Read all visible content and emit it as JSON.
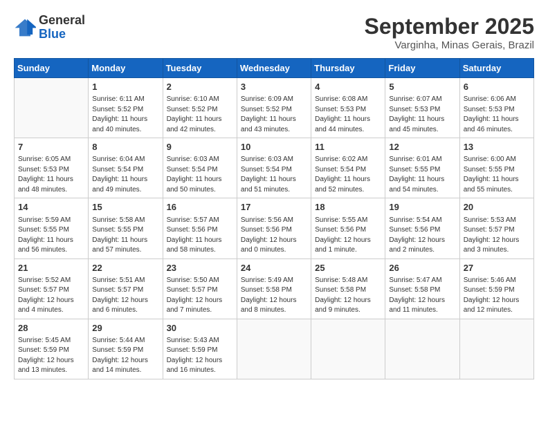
{
  "header": {
    "logo_line1": "General",
    "logo_line2": "Blue",
    "month": "September 2025",
    "location": "Varginha, Minas Gerais, Brazil"
  },
  "weekdays": [
    "Sunday",
    "Monday",
    "Tuesday",
    "Wednesday",
    "Thursday",
    "Friday",
    "Saturday"
  ],
  "weeks": [
    [
      {
        "day": "",
        "sunrise": "",
        "sunset": "",
        "daylight": ""
      },
      {
        "day": "1",
        "sunrise": "6:11 AM",
        "sunset": "5:52 PM",
        "daylight": "11 hours and 40 minutes."
      },
      {
        "day": "2",
        "sunrise": "6:10 AM",
        "sunset": "5:52 PM",
        "daylight": "11 hours and 42 minutes."
      },
      {
        "day": "3",
        "sunrise": "6:09 AM",
        "sunset": "5:52 PM",
        "daylight": "11 hours and 43 minutes."
      },
      {
        "day": "4",
        "sunrise": "6:08 AM",
        "sunset": "5:53 PM",
        "daylight": "11 hours and 44 minutes."
      },
      {
        "day": "5",
        "sunrise": "6:07 AM",
        "sunset": "5:53 PM",
        "daylight": "11 hours and 45 minutes."
      },
      {
        "day": "6",
        "sunrise": "6:06 AM",
        "sunset": "5:53 PM",
        "daylight": "11 hours and 46 minutes."
      }
    ],
    [
      {
        "day": "7",
        "sunrise": "6:05 AM",
        "sunset": "5:53 PM",
        "daylight": "11 hours and 48 minutes."
      },
      {
        "day": "8",
        "sunrise": "6:04 AM",
        "sunset": "5:54 PM",
        "daylight": "11 hours and 49 minutes."
      },
      {
        "day": "9",
        "sunrise": "6:03 AM",
        "sunset": "5:54 PM",
        "daylight": "11 hours and 50 minutes."
      },
      {
        "day": "10",
        "sunrise": "6:03 AM",
        "sunset": "5:54 PM",
        "daylight": "11 hours and 51 minutes."
      },
      {
        "day": "11",
        "sunrise": "6:02 AM",
        "sunset": "5:54 PM",
        "daylight": "11 hours and 52 minutes."
      },
      {
        "day": "12",
        "sunrise": "6:01 AM",
        "sunset": "5:55 PM",
        "daylight": "11 hours and 54 minutes."
      },
      {
        "day": "13",
        "sunrise": "6:00 AM",
        "sunset": "5:55 PM",
        "daylight": "11 hours and 55 minutes."
      }
    ],
    [
      {
        "day": "14",
        "sunrise": "5:59 AM",
        "sunset": "5:55 PM",
        "daylight": "11 hours and 56 minutes."
      },
      {
        "day": "15",
        "sunrise": "5:58 AM",
        "sunset": "5:55 PM",
        "daylight": "11 hours and 57 minutes."
      },
      {
        "day": "16",
        "sunrise": "5:57 AM",
        "sunset": "5:56 PM",
        "daylight": "11 hours and 58 minutes."
      },
      {
        "day": "17",
        "sunrise": "5:56 AM",
        "sunset": "5:56 PM",
        "daylight": "12 hours and 0 minutes."
      },
      {
        "day": "18",
        "sunrise": "5:55 AM",
        "sunset": "5:56 PM",
        "daylight": "12 hours and 1 minute."
      },
      {
        "day": "19",
        "sunrise": "5:54 AM",
        "sunset": "5:56 PM",
        "daylight": "12 hours and 2 minutes."
      },
      {
        "day": "20",
        "sunrise": "5:53 AM",
        "sunset": "5:57 PM",
        "daylight": "12 hours and 3 minutes."
      }
    ],
    [
      {
        "day": "21",
        "sunrise": "5:52 AM",
        "sunset": "5:57 PM",
        "daylight": "12 hours and 4 minutes."
      },
      {
        "day": "22",
        "sunrise": "5:51 AM",
        "sunset": "5:57 PM",
        "daylight": "12 hours and 6 minutes."
      },
      {
        "day": "23",
        "sunrise": "5:50 AM",
        "sunset": "5:57 PM",
        "daylight": "12 hours and 7 minutes."
      },
      {
        "day": "24",
        "sunrise": "5:49 AM",
        "sunset": "5:58 PM",
        "daylight": "12 hours and 8 minutes."
      },
      {
        "day": "25",
        "sunrise": "5:48 AM",
        "sunset": "5:58 PM",
        "daylight": "12 hours and 9 minutes."
      },
      {
        "day": "26",
        "sunrise": "5:47 AM",
        "sunset": "5:58 PM",
        "daylight": "12 hours and 11 minutes."
      },
      {
        "day": "27",
        "sunrise": "5:46 AM",
        "sunset": "5:59 PM",
        "daylight": "12 hours and 12 minutes."
      }
    ],
    [
      {
        "day": "28",
        "sunrise": "5:45 AM",
        "sunset": "5:59 PM",
        "daylight": "12 hours and 13 minutes."
      },
      {
        "day": "29",
        "sunrise": "5:44 AM",
        "sunset": "5:59 PM",
        "daylight": "12 hours and 14 minutes."
      },
      {
        "day": "30",
        "sunrise": "5:43 AM",
        "sunset": "5:59 PM",
        "daylight": "12 hours and 16 minutes."
      },
      {
        "day": "",
        "sunrise": "",
        "sunset": "",
        "daylight": ""
      },
      {
        "day": "",
        "sunrise": "",
        "sunset": "",
        "daylight": ""
      },
      {
        "day": "",
        "sunrise": "",
        "sunset": "",
        "daylight": ""
      },
      {
        "day": "",
        "sunrise": "",
        "sunset": "",
        "daylight": ""
      }
    ]
  ],
  "labels": {
    "sunrise_prefix": "Sunrise: ",
    "sunset_prefix": "Sunset: ",
    "daylight_prefix": "Daylight: "
  }
}
